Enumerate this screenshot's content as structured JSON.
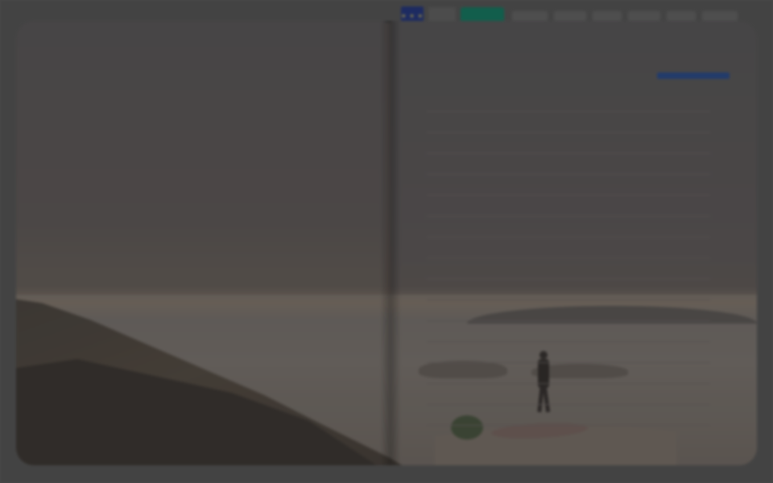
{
  "topbar": {
    "flag_label": "★ ★ ★",
    "pill_1": "",
    "pill_2": ""
  },
  "left_page": {
    "date": "",
    "title": "",
    "body": ""
  },
  "right_page": {
    "logo_text": "",
    "notes_label": ""
  },
  "colors": {
    "background": "#4a4a4a",
    "brand_blue": "#1a3a6d",
    "accent_green": "#0e6b55"
  },
  "icons": {
    "flag": "eu-flag-icon",
    "logo": "brand-logo-icon"
  }
}
